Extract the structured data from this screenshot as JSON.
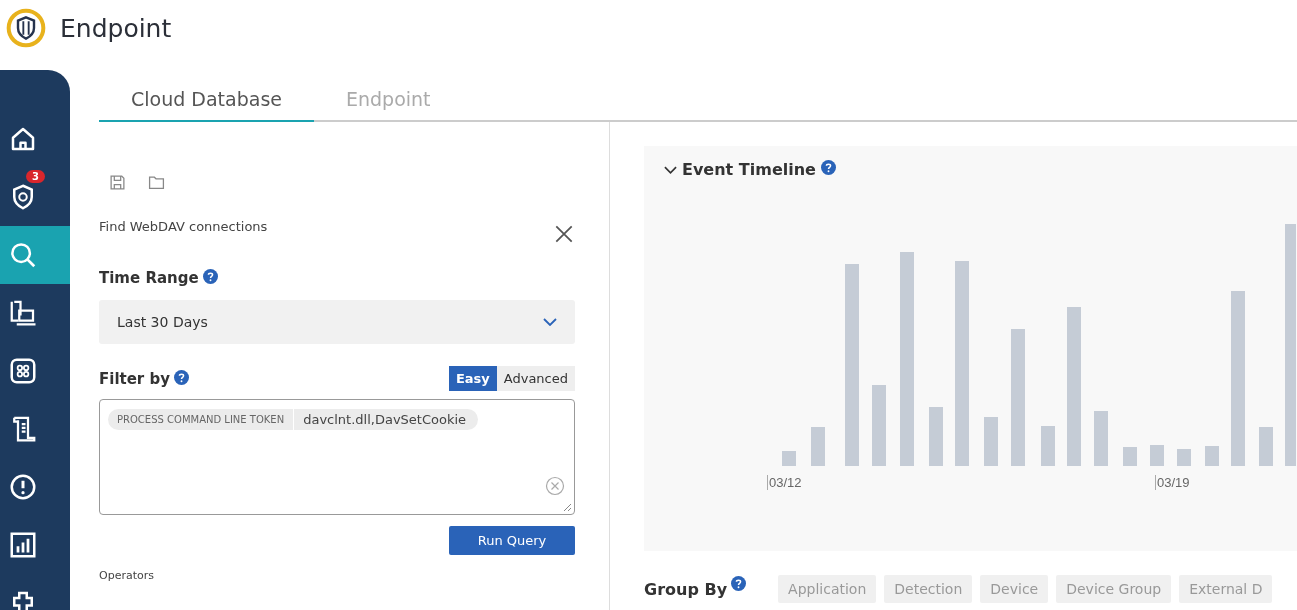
{
  "app": {
    "title": "Endpoint"
  },
  "sidebar": {
    "items": [
      {
        "kind": "home",
        "selected": false
      },
      {
        "kind": "shield",
        "selected": false,
        "badge": "3"
      },
      {
        "kind": "search",
        "selected": true
      },
      {
        "kind": "devices",
        "selected": false
      },
      {
        "kind": "apps",
        "selected": false
      },
      {
        "kind": "scroll",
        "selected": false
      },
      {
        "kind": "alert",
        "selected": false
      },
      {
        "kind": "report",
        "selected": false
      },
      {
        "kind": "puzzle",
        "selected": false
      }
    ]
  },
  "tabs": [
    {
      "label": "Cloud Database",
      "selected": true
    },
    {
      "label": "Endpoint",
      "selected": false
    }
  ],
  "query": {
    "name": "Find WebDAV connections",
    "time_range": {
      "label": "Time Range",
      "value": "Last 30 Days"
    },
    "filter": {
      "label": "Filter by",
      "modes": [
        {
          "label": "Easy",
          "selected": true
        },
        {
          "label": "Advanced",
          "selected": false
        }
      ],
      "tokens": [
        {
          "field": "PROCESS COMMAND LINE TOKEN",
          "value": "davclnt.dll,DavSetCookie"
        }
      ]
    },
    "run_button": "Run Query",
    "operators_label": "Operators"
  },
  "timeline": {
    "title": "Event Timeline",
    "expanded": true,
    "x_labels": [
      "03/12",
      "03/19"
    ]
  },
  "group_by": {
    "label": "Group By",
    "options": [
      "Application",
      "Detection",
      "Device",
      "Device Group",
      "External D"
    ]
  }
}
